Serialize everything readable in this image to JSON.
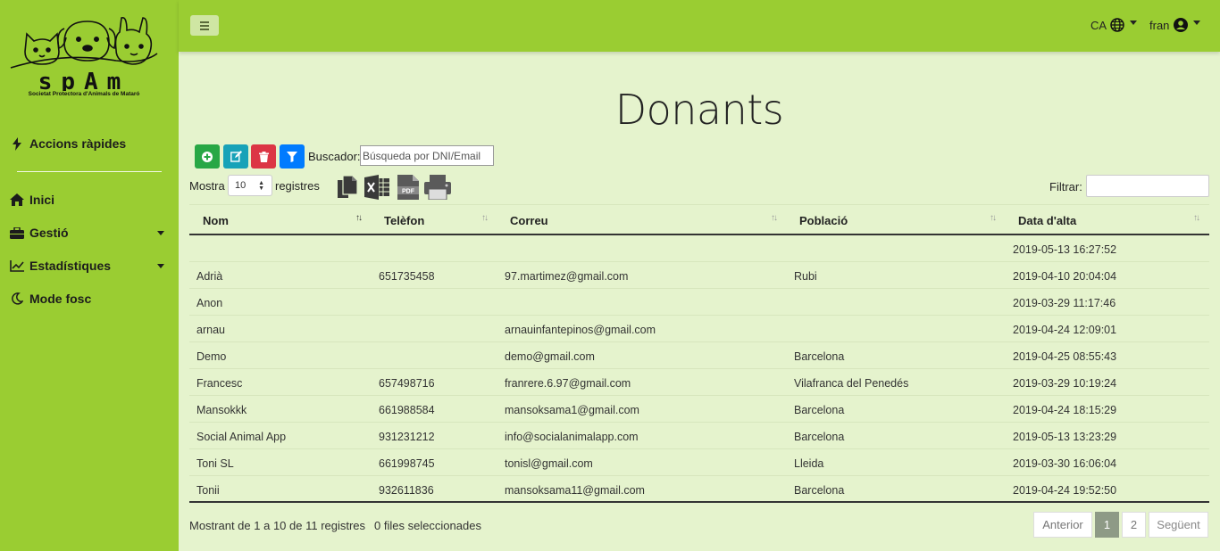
{
  "brand": {
    "name": "spAm",
    "subtitle": "Societat Protectora d'Animals de Mataró"
  },
  "sidebar": {
    "quick": "Accions ràpides",
    "items": [
      {
        "label": "Inici",
        "icon": "home-icon"
      },
      {
        "label": "Gestió",
        "icon": "briefcase-icon",
        "dropdown": true
      },
      {
        "label": "Estadístiques",
        "icon": "chart-icon",
        "dropdown": true
      },
      {
        "label": "Mode fosc",
        "icon": "moon-icon"
      }
    ]
  },
  "topbar": {
    "lang": "CA",
    "user": "fran"
  },
  "page": {
    "title": "Donants"
  },
  "toolbar": {
    "search_label": "Buscador:",
    "search_placeholder": "Búsqueda por DNI/Email",
    "show_prefix": "Mostra",
    "page_length": "10",
    "show_suffix": "registres",
    "filter_label": "Filtrar:"
  },
  "table": {
    "columns": [
      "Nom",
      "Telèfon",
      "Correu",
      "Població",
      "Data d'alta"
    ],
    "rows": [
      [
        "",
        "",
        "",
        "",
        "2019-05-13 16:27:52"
      ],
      [
        "Adrià",
        "651735458",
        "97.martimez@gmail.com",
        "Rubi",
        "2019-04-10 20:04:04"
      ],
      [
        "Anon",
        "",
        "",
        "",
        "2019-03-29 11:17:46"
      ],
      [
        "arnau",
        "",
        "arnauinfantepinos@gmail.com",
        "",
        "2019-04-24 12:09:01"
      ],
      [
        "Demo",
        "",
        "demo@gmail.com",
        "Barcelona",
        "2019-04-25 08:55:43"
      ],
      [
        "Francesc",
        "657498716",
        "franrere.6.97@gmail.com",
        "Vilafranca del Penedés",
        "2019-03-29 10:19:24"
      ],
      [
        "Mansokkk",
        "661988584",
        "mansoksama1@gmail.com",
        "Barcelona",
        "2019-04-24 18:15:29"
      ],
      [
        "Social Animal App",
        "931231212",
        "info@socialanimalapp.com",
        "Barcelona",
        "2019-05-13 13:23:29"
      ],
      [
        "Toni SL",
        "661998745",
        "tonisl@gmail.com",
        "Lleida",
        "2019-03-30 16:06:04"
      ],
      [
        "Tonii",
        "932611836",
        "mansoksama11@gmail.com",
        "Barcelona",
        "2019-04-24 19:52:50"
      ]
    ]
  },
  "footer": {
    "info": "Mostrant de 1 a 10 de 11 registres",
    "selected": "0 files seleccionades",
    "prev": "Anterior",
    "pages": [
      "1",
      "2"
    ],
    "next": "Següent"
  },
  "colors": {
    "sidebar": "#9acd32",
    "content": "#e5f3cd",
    "add": "#28a745",
    "edit": "#17a2b8",
    "delete": "#dc3545",
    "filter": "#007bff"
  }
}
